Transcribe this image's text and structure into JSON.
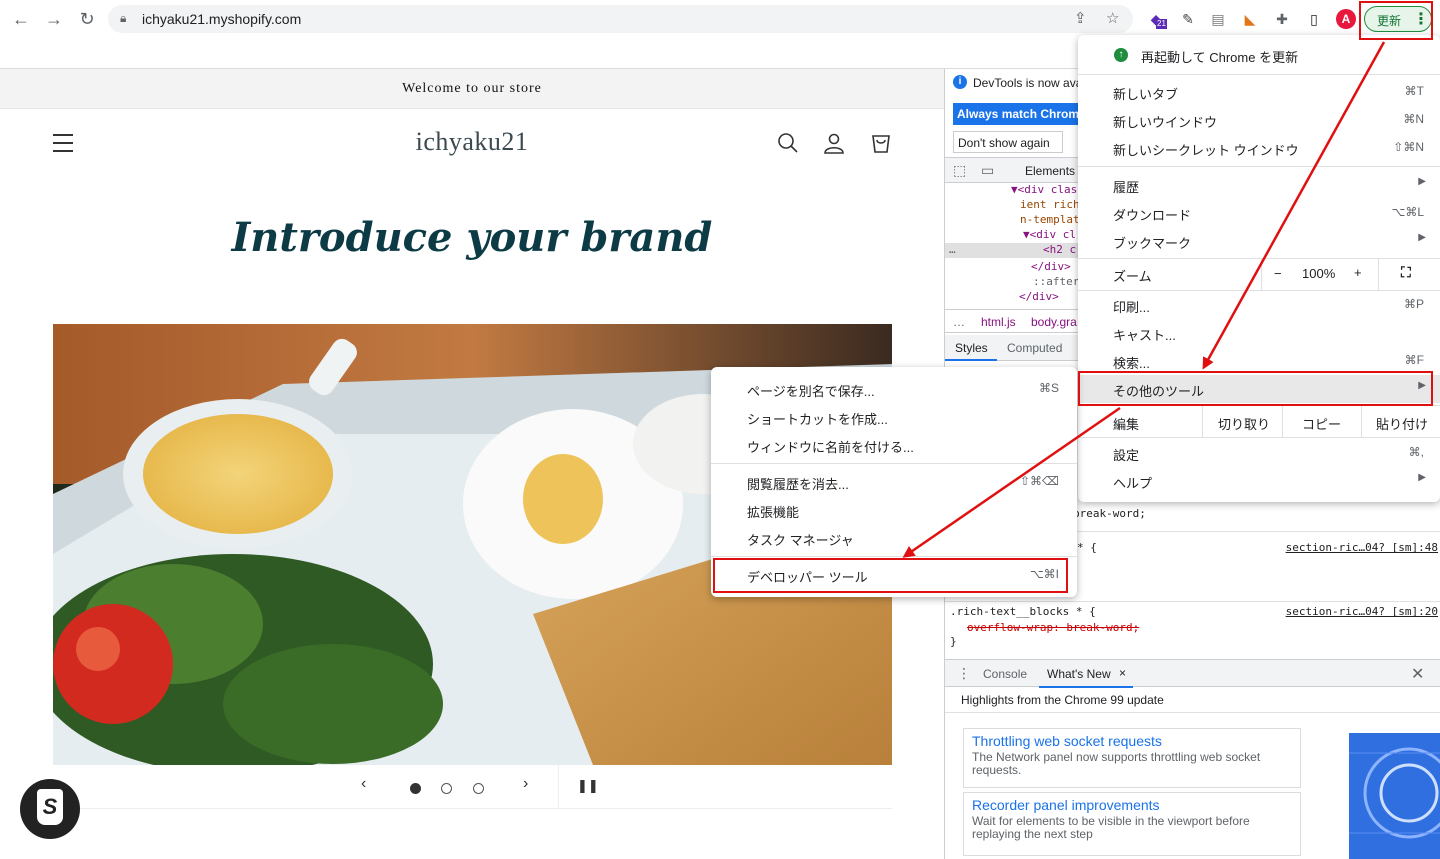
{
  "browser": {
    "url": "ichyaku21.myshopify.com",
    "update_label": "更新",
    "profile_initial": "A",
    "ext_badge": "21"
  },
  "page": {
    "announcement": "Welcome to our store",
    "logo": "ichyaku21",
    "hero_title": "Introduce your brand"
  },
  "devtools": {
    "notice": "DevTools is now ava",
    "match_button": "Always match Chrome",
    "dont_show": "Don't show again",
    "tab_elements": "Elements",
    "dom_lines": [
      "▼<div clas",
      "ient rich",
      "n-templat",
      "▼<div cl",
      "<h2 c",
      "</div>",
      "::after",
      "</div>"
    ],
    "crumb_html": "html.js",
    "crumb_body": "body.gra",
    "tab_styles": "Styles",
    "tab_computed": "Computed",
    "css": {
      "l1": "break-word;",
      "l2": "* {",
      "link1": "section-ric…04? [sm]:48",
      "l3": ".rich-text__blocks * {",
      "link2": "section-ric…04? [sm]:20",
      "l4": "overflow-wrap: break-word;",
      "l5": "}"
    },
    "drawer_console": "Console",
    "drawer_whatsnew": "What's New",
    "highlights": "Highlights from the Chrome 99 update",
    "cards": [
      {
        "title": "Throttling web socket requests",
        "desc": "The Network panel now supports throttling web socket requests."
      },
      {
        "title": "Recorder panel improvements",
        "desc": "Wait for elements to be visible in the viewport before replaying the next step"
      }
    ]
  },
  "chrome_menu": {
    "relaunch": "再起動して Chrome を更新",
    "new_tab": "新しいタブ",
    "new_tab_key": "⌘T",
    "new_window": "新しいウインドウ",
    "new_window_key": "⌘N",
    "incognito": "新しいシークレット ウインドウ",
    "incognito_key": "⇧⌘N",
    "history": "履歴",
    "downloads": "ダウンロード",
    "downloads_key": "⌥⌘L",
    "bookmarks": "ブックマーク",
    "zoom": "ズーム",
    "zoom_minus": "−",
    "zoom_value": "100%",
    "zoom_plus": "+",
    "print": "印刷...",
    "print_key": "⌘P",
    "cast": "キャスト...",
    "find": "検索...",
    "find_key": "⌘F",
    "more_tools": "その他のツール",
    "edit": "編集",
    "cut": "切り取り",
    "copy": "コピー",
    "paste": "貼り付け",
    "settings": "設定",
    "settings_key": "⌘,",
    "help": "ヘルプ"
  },
  "sub_menu": {
    "save_as": "ページを別名で保存...",
    "save_as_key": "⌘S",
    "shortcut": "ショートカットを作成...",
    "name_window": "ウィンドウに名前を付ける...",
    "clear": "閲覧履歴を消去...",
    "clear_key": "⇧⌘⌫",
    "extensions": "拡張機能",
    "task_manager": "タスク マネージャ",
    "devtools": "デベロッパー ツール",
    "devtools_key": "⌥⌘I"
  },
  "colors": {
    "accent": "#0d3b45",
    "annotation": "#e01010",
    "update_green": "#137333"
  }
}
